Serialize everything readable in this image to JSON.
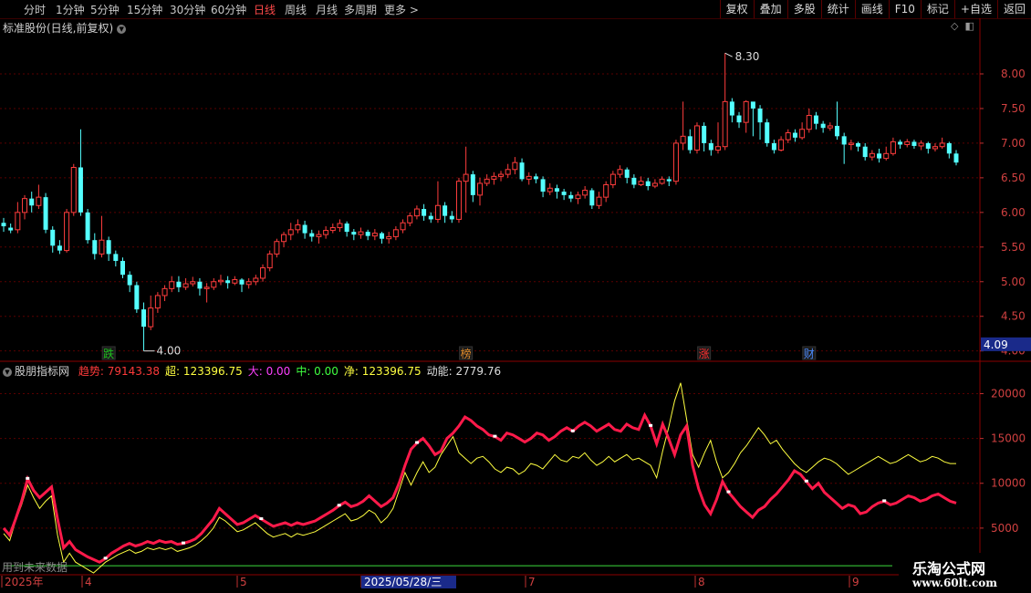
{
  "toolbar": {
    "timeframes": [
      {
        "label": "分时",
        "active": false
      },
      {
        "label": "1分钟",
        "active": false
      },
      {
        "label": "5分钟",
        "active": false
      },
      {
        "label": "15分钟",
        "active": false
      },
      {
        "label": "30分钟",
        "active": false
      },
      {
        "label": "60分钟",
        "active": false
      },
      {
        "label": "日线",
        "active": true
      },
      {
        "label": "周线",
        "active": false
      },
      {
        "label": "月线",
        "active": false
      },
      {
        "label": "多周期",
        "active": false
      },
      {
        "label": "更多 >",
        "active": false
      }
    ],
    "tools": [
      "复权",
      "叠加",
      "多股",
      "统计",
      "画线",
      "F10",
      "标记",
      "+自选",
      "返回"
    ]
  },
  "main": {
    "title": "标准股份(日线,前复权)",
    "price_axis": [
      "8.00",
      "7.50",
      "7.00",
      "6.50",
      "6.00",
      "5.50",
      "5.00",
      "4.50",
      "4.00"
    ],
    "current_price": "4.09",
    "high_label": "8.30",
    "low_label": "4.00",
    "markers": [
      {
        "text": "跌",
        "color": "#1ec31e"
      },
      {
        "text": "榜",
        "color": "#e08b2a"
      },
      {
        "text": "涨",
        "color": "#ff3030"
      },
      {
        "text": "财",
        "color": "#4d8cff"
      }
    ]
  },
  "indicator": {
    "name": "股朋指标网",
    "items": [
      {
        "label": "趋势",
        "value": "79143.38",
        "color": "#ff3a3a"
      },
      {
        "label": "超",
        "value": "123396.75",
        "color": "#ffff40"
      },
      {
        "label": "大",
        "value": "0.00",
        "color": "#ff40ff"
      },
      {
        "label": "中",
        "value": "0.00",
        "color": "#40ff40"
      },
      {
        "label": "净",
        "value": "123396.75",
        "color": "#ffff40"
      },
      {
        "label": "动能",
        "value": "2779.76",
        "color": "#dddddd"
      }
    ],
    "axis": [
      "20000",
      "15000",
      "10000",
      "5000"
    ],
    "future_text": "用到未来数据"
  },
  "date_axis": {
    "labels": [
      "2025年",
      "4",
      "5",
      "2025/05/28/三",
      "7",
      "8",
      "9"
    ],
    "highlight": "2025/05/28/三"
  },
  "watermark": {
    "line1": "乐淘公式网",
    "line2": "www.60lt.com"
  },
  "colors": {
    "up": "#ff3d3d",
    "down": "#54ffff",
    "grid": "#5a0000",
    "trend": "#ff1a4a",
    "super": "#ffff40",
    "zero": "#3ddc3d"
  },
  "chart_data": {
    "type": "candlestick",
    "price_range": [
      3.93,
      8.54
    ],
    "indicator_range": [
      0,
      23000
    ],
    "indicator_zero_line": 800,
    "candles": [
      [
        5.85,
        5.8,
        5.92,
        5.72
      ],
      [
        5.78,
        5.74,
        5.84,
        5.7
      ],
      [
        5.75,
        6.0,
        6.15,
        5.7
      ],
      [
        6.0,
        6.2,
        6.25,
        5.9
      ],
      [
        6.2,
        6.1,
        6.3,
        6.0
      ],
      [
        6.1,
        6.22,
        6.4,
        6.05
      ],
      [
        6.22,
        5.75,
        6.28,
        5.7
      ],
      [
        5.75,
        5.52,
        5.8,
        5.42
      ],
      [
        5.52,
        5.45,
        5.6,
        5.4
      ],
      [
        5.45,
        6.0,
        6.05,
        5.42
      ],
      [
        6.0,
        6.65,
        6.7,
        5.95
      ],
      [
        6.65,
        6.0,
        7.2,
        5.95
      ],
      [
        6.0,
        5.6,
        6.05,
        5.55
      ],
      [
        5.6,
        5.4,
        5.7,
        5.32
      ],
      [
        5.4,
        5.6,
        5.95,
        5.35
      ],
      [
        5.6,
        5.4,
        5.65,
        5.3
      ],
      [
        5.4,
        5.3,
        5.45,
        5.22
      ],
      [
        5.3,
        5.1,
        5.35,
        5.05
      ],
      [
        5.1,
        4.95,
        5.15,
        4.85
      ],
      [
        4.95,
        4.6,
        5.0,
        4.55
      ],
      [
        4.6,
        4.35,
        4.7,
        4.0
      ],
      [
        4.35,
        4.62,
        4.8,
        4.3
      ],
      [
        4.62,
        4.8,
        4.85,
        4.55
      ],
      [
        4.8,
        4.9,
        4.95,
        4.72
      ],
      [
        4.9,
        5.0,
        5.08,
        4.85
      ],
      [
        5.0,
        4.92,
        5.08,
        4.85
      ],
      [
        4.92,
        4.97,
        5.05,
        4.88
      ],
      [
        4.97,
        5.0,
        5.07,
        4.93
      ],
      [
        5.0,
        4.9,
        5.05,
        4.8
      ],
      [
        4.9,
        4.92,
        4.98,
        4.7
      ],
      [
        4.92,
        5.0,
        5.05,
        4.88
      ],
      [
        5.0,
        5.02,
        5.1,
        4.95
      ],
      [
        5.02,
        4.98,
        5.08,
        4.9
      ],
      [
        4.98,
        5.03,
        5.08,
        4.95
      ],
      [
        5.03,
        4.96,
        5.05,
        4.85
      ],
      [
        4.96,
        5.0,
        5.05,
        4.9
      ],
      [
        5.0,
        5.05,
        5.1,
        4.95
      ],
      [
        5.05,
        5.2,
        5.25,
        5.0
      ],
      [
        5.2,
        5.4,
        5.45,
        5.15
      ],
      [
        5.4,
        5.58,
        5.62,
        5.35
      ],
      [
        5.58,
        5.68,
        5.72,
        5.5
      ],
      [
        5.68,
        5.75,
        5.85,
        5.6
      ],
      [
        5.75,
        5.82,
        5.9,
        5.7
      ],
      [
        5.82,
        5.7,
        5.88,
        5.62
      ],
      [
        5.7,
        5.65,
        5.75,
        5.58
      ],
      [
        5.65,
        5.68,
        5.74,
        5.55
      ],
      [
        5.68,
        5.74,
        5.8,
        5.62
      ],
      [
        5.74,
        5.78,
        5.84,
        5.7
      ],
      [
        5.78,
        5.84,
        5.9,
        5.72
      ],
      [
        5.84,
        5.72,
        5.87,
        5.65
      ],
      [
        5.72,
        5.68,
        5.76,
        5.6
      ],
      [
        5.68,
        5.72,
        5.78,
        5.62
      ],
      [
        5.72,
        5.66,
        5.75,
        5.6
      ],
      [
        5.66,
        5.7,
        5.76,
        5.6
      ],
      [
        5.7,
        5.62,
        5.72,
        5.55
      ],
      [
        5.62,
        5.65,
        5.72,
        5.55
      ],
      [
        5.65,
        5.75,
        5.8,
        5.6
      ],
      [
        5.75,
        5.85,
        5.9,
        5.7
      ],
      [
        5.85,
        5.95,
        6.0,
        5.8
      ],
      [
        5.95,
        6.05,
        6.1,
        5.9
      ],
      [
        6.05,
        5.95,
        6.12,
        5.88
      ],
      [
        5.95,
        5.9,
        6.0,
        5.85
      ],
      [
        5.9,
        6.1,
        6.45,
        5.85
      ],
      [
        6.1,
        5.95,
        6.15,
        5.85
      ],
      [
        5.95,
        5.9,
        6.02,
        5.85
      ],
      [
        5.9,
        6.45,
        6.5,
        5.85
      ],
      [
        6.45,
        6.55,
        6.95,
        6.0
      ],
      [
        6.55,
        6.25,
        6.6,
        6.15
      ],
      [
        6.25,
        6.42,
        6.5,
        6.1
      ],
      [
        6.42,
        6.48,
        6.55,
        6.38
      ],
      [
        6.48,
        6.52,
        6.58,
        6.4
      ],
      [
        6.52,
        6.55,
        6.6,
        6.45
      ],
      [
        6.55,
        6.62,
        6.7,
        6.5
      ],
      [
        6.62,
        6.72,
        6.8,
        6.55
      ],
      [
        6.72,
        6.48,
        6.78,
        6.45
      ],
      [
        6.48,
        6.52,
        6.58,
        6.4
      ],
      [
        6.52,
        6.48,
        6.56,
        6.42
      ],
      [
        6.48,
        6.3,
        6.52,
        6.22
      ],
      [
        6.3,
        6.35,
        6.42,
        6.25
      ],
      [
        6.35,
        6.3,
        6.4,
        6.2
      ],
      [
        6.3,
        6.25,
        6.34,
        6.18
      ],
      [
        6.25,
        6.2,
        6.3,
        6.15
      ],
      [
        6.2,
        6.25,
        6.3,
        6.12
      ],
      [
        6.25,
        6.32,
        6.38,
        6.2
      ],
      [
        6.32,
        6.1,
        6.35,
        6.05
      ],
      [
        6.1,
        6.22,
        6.3,
        6.05
      ],
      [
        6.22,
        6.4,
        6.45,
        6.15
      ],
      [
        6.4,
        6.55,
        6.6,
        6.35
      ],
      [
        6.55,
        6.62,
        6.68,
        6.5
      ],
      [
        6.62,
        6.5,
        6.65,
        6.42
      ],
      [
        6.5,
        6.4,
        6.55,
        6.35
      ],
      [
        6.4,
        6.45,
        6.52,
        6.38
      ],
      [
        6.45,
        6.38,
        6.5,
        6.32
      ],
      [
        6.38,
        6.42,
        6.48,
        6.35
      ],
      [
        6.42,
        6.48,
        6.52,
        6.4
      ],
      [
        6.48,
        6.45,
        6.52,
        6.38
      ],
      [
        6.45,
        7.0,
        7.05,
        6.4
      ],
      [
        7.0,
        7.1,
        7.6,
        6.9
      ],
      [
        7.1,
        6.9,
        7.2,
        6.85
      ],
      [
        6.9,
        7.25,
        7.3,
        6.85
      ],
      [
        7.25,
        7.0,
        7.3,
        6.88
      ],
      [
        7.0,
        6.9,
        7.05,
        6.82
      ],
      [
        6.9,
        6.95,
        7.3,
        6.85
      ],
      [
        6.95,
        7.6,
        8.3,
        6.9
      ],
      [
        7.6,
        7.4,
        7.65,
        7.3
      ],
      [
        7.4,
        7.3,
        7.45,
        7.22
      ],
      [
        7.3,
        7.6,
        7.62,
        7.15
      ],
      [
        7.6,
        7.5,
        7.58,
        7.1
      ],
      [
        7.5,
        7.3,
        7.55,
        7.05
      ],
      [
        7.3,
        7.0,
        7.35,
        6.95
      ],
      [
        7.0,
        6.9,
        7.05,
        6.85
      ],
      [
        6.9,
        7.05,
        7.1,
        6.88
      ],
      [
        7.05,
        7.15,
        7.2,
        7.0
      ],
      [
        7.15,
        7.08,
        7.2,
        7.02
      ],
      [
        7.08,
        7.2,
        7.3,
        7.05
      ],
      [
        7.2,
        7.4,
        7.5,
        7.15
      ],
      [
        7.4,
        7.28,
        7.45,
        7.2
      ],
      [
        7.28,
        7.22,
        7.32,
        7.15
      ],
      [
        7.22,
        7.25,
        7.3,
        7.18
      ],
      [
        7.25,
        7.1,
        7.6,
        7.05
      ],
      [
        7.1,
        6.98,
        7.15,
        6.7
      ],
      [
        6.98,
        7.0,
        7.05,
        6.9
      ],
      [
        7.0,
        6.95,
        7.02,
        6.88
      ],
      [
        6.95,
        6.8,
        7.0,
        6.75
      ],
      [
        6.8,
        6.85,
        6.9,
        6.75
      ],
      [
        6.85,
        6.78,
        6.92,
        6.72
      ],
      [
        6.78,
        6.85,
        6.95,
        6.75
      ],
      [
        6.85,
        7.02,
        7.08,
        6.82
      ],
      [
        7.02,
        6.98,
        7.05,
        6.92
      ],
      [
        6.98,
        7.02,
        7.06,
        6.94
      ],
      [
        7.02,
        6.96,
        7.05,
        6.92
      ],
      [
        6.96,
        7.0,
        7.04,
        6.9
      ],
      [
        7.0,
        6.92,
        7.02,
        6.85
      ],
      [
        6.92,
        6.95,
        7.0,
        6.88
      ],
      [
        6.95,
        7.0,
        7.08,
        6.92
      ],
      [
        7.0,
        6.85,
        7.02,
        6.78
      ],
      [
        6.85,
        6.72,
        6.9,
        6.68
      ]
    ],
    "trend": [
      5000,
      4200,
      6000,
      8000,
      10500,
      9200,
      8400,
      9000,
      9600,
      6000,
      2800,
      3500,
      2600,
      2200,
      1800,
      1500,
      1200,
      1600,
      2200,
      2600,
      3000,
      3300,
      3000,
      3200,
      3500,
      3300,
      3600,
      3400,
      3500,
      3200,
      3300,
      3500,
      3800,
      4400,
      5200,
      6000,
      7200,
      6600,
      6000,
      5400,
      5600,
      6000,
      6400,
      6000,
      5600,
      5200,
      5400,
      5600,
      5300,
      5600,
      5400,
      5600,
      5800,
      6200,
      6600,
      7000,
      7500,
      7900,
      7400,
      7600,
      8000,
      8600,
      8000,
      7400,
      7800,
      8400,
      10000,
      12000,
      13800,
      14500,
      15000,
      14200,
      13200,
      13600,
      15000,
      15600,
      16400,
      17400,
      17000,
      16400,
      16000,
      15400,
      15200,
      14800,
      15600,
      15400,
      15000,
      14600,
      15000,
      15600,
      15400,
      14800,
      15200,
      15800,
      16200,
      15800,
      16400,
      16800,
      16400,
      15800,
      16200,
      16600,
      16000,
      15800,
      16600,
      16200,
      16000,
      17600,
      16400,
      14400,
      16600,
      15000,
      13200,
      15400,
      16400,
      12000,
      9400,
      7600,
      6600,
      8200,
      10200,
      9000,
      8200,
      7400,
      6800,
      6200,
      7000,
      7400,
      8200,
      8800,
      9600,
      10400,
      11400,
      11000,
      10200,
      9400,
      10000,
      9000,
      8400,
      7800,
      7200,
      7600,
      7400,
      6600,
      6800,
      7400,
      7800,
      8000,
      7600,
      7800,
      8200,
      8600,
      8400,
      8000,
      8200,
      8600,
      8800,
      8400,
      8000,
      7800
    ],
    "super": [
      4400,
      3600,
      5800,
      7600,
      9800,
      8400,
      7200,
      8000,
      8600,
      4200,
      1200,
      2200,
      1200,
      800,
      400,
      0,
      600,
      1200,
      1600,
      2000,
      2300,
      2600,
      2200,
      2400,
      2800,
      2600,
      2800,
      2600,
      2800,
      2400,
      2600,
      2800,
      3100,
      3600,
      4200,
      5000,
      6200,
      5800,
      5200,
      4600,
      4800,
      5200,
      5600,
      5000,
      4400,
      4000,
      4200,
      4400,
      4000,
      4400,
      4200,
      4400,
      4600,
      5000,
      5400,
      5800,
      6200,
      6600,
      5800,
      6000,
      6400,
      7000,
      6600,
      5600,
      6200,
      7200,
      9200,
      11200,
      9800,
      11200,
      12400,
      11200,
      11800,
      13200,
      14200,
      15200,
      13400,
      12800,
      12200,
      12800,
      13000,
      12400,
      11600,
      11200,
      11800,
      11600,
      11000,
      11400,
      12200,
      12000,
      11600,
      12400,
      13200,
      12600,
      12400,
      13000,
      12800,
      13400,
      12600,
      12000,
      12400,
      13000,
      12400,
      12800,
      13200,
      12600,
      12800,
      12400,
      12000,
      10600,
      13600,
      16200,
      19200,
      21200,
      17200,
      13200,
      11800,
      13400,
      14800,
      12400,
      10600,
      11200,
      12200,
      13400,
      14200,
      15200,
      16200,
      15400,
      14400,
      14800,
      13800,
      13000,
      12200,
      11600,
      11200,
      11800,
      12400,
      12800,
      12600,
      12200,
      11600,
      11000,
      11400,
      11800,
      12200,
      12600,
      13000,
      12600,
      12200,
      12400,
      12800,
      13200,
      12800,
      12400,
      12600,
      13000,
      12800,
      12400,
      12200,
      12200
    ]
  }
}
